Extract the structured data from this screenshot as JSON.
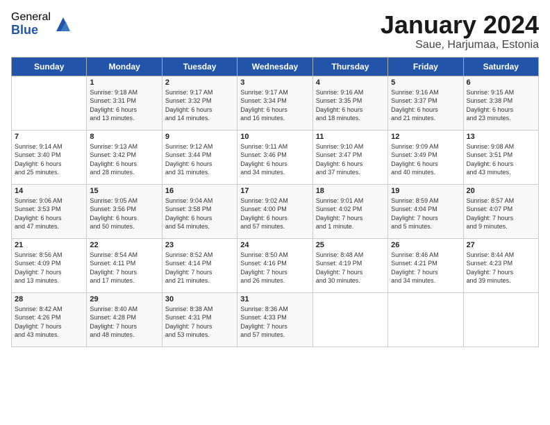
{
  "logo": {
    "general": "General",
    "blue": "Blue"
  },
  "title": "January 2024",
  "location": "Saue, Harjumaa, Estonia",
  "days_header": [
    "Sunday",
    "Monday",
    "Tuesday",
    "Wednesday",
    "Thursday",
    "Friday",
    "Saturday"
  ],
  "weeks": [
    [
      {
        "day": "",
        "info": ""
      },
      {
        "day": "1",
        "info": "Sunrise: 9:18 AM\nSunset: 3:31 PM\nDaylight: 6 hours\nand 13 minutes."
      },
      {
        "day": "2",
        "info": "Sunrise: 9:17 AM\nSunset: 3:32 PM\nDaylight: 6 hours\nand 14 minutes."
      },
      {
        "day": "3",
        "info": "Sunrise: 9:17 AM\nSunset: 3:34 PM\nDaylight: 6 hours\nand 16 minutes."
      },
      {
        "day": "4",
        "info": "Sunrise: 9:16 AM\nSunset: 3:35 PM\nDaylight: 6 hours\nand 18 minutes."
      },
      {
        "day": "5",
        "info": "Sunrise: 9:16 AM\nSunset: 3:37 PM\nDaylight: 6 hours\nand 21 minutes."
      },
      {
        "day": "6",
        "info": "Sunrise: 9:15 AM\nSunset: 3:38 PM\nDaylight: 6 hours\nand 23 minutes."
      }
    ],
    [
      {
        "day": "7",
        "info": "Sunrise: 9:14 AM\nSunset: 3:40 PM\nDaylight: 6 hours\nand 25 minutes."
      },
      {
        "day": "8",
        "info": "Sunrise: 9:13 AM\nSunset: 3:42 PM\nDaylight: 6 hours\nand 28 minutes."
      },
      {
        "day": "9",
        "info": "Sunrise: 9:12 AM\nSunset: 3:44 PM\nDaylight: 6 hours\nand 31 minutes."
      },
      {
        "day": "10",
        "info": "Sunrise: 9:11 AM\nSunset: 3:46 PM\nDaylight: 6 hours\nand 34 minutes."
      },
      {
        "day": "11",
        "info": "Sunrise: 9:10 AM\nSunset: 3:47 PM\nDaylight: 6 hours\nand 37 minutes."
      },
      {
        "day": "12",
        "info": "Sunrise: 9:09 AM\nSunset: 3:49 PM\nDaylight: 6 hours\nand 40 minutes."
      },
      {
        "day": "13",
        "info": "Sunrise: 9:08 AM\nSunset: 3:51 PM\nDaylight: 6 hours\nand 43 minutes."
      }
    ],
    [
      {
        "day": "14",
        "info": "Sunrise: 9:06 AM\nSunset: 3:53 PM\nDaylight: 6 hours\nand 47 minutes."
      },
      {
        "day": "15",
        "info": "Sunrise: 9:05 AM\nSunset: 3:56 PM\nDaylight: 6 hours\nand 50 minutes."
      },
      {
        "day": "16",
        "info": "Sunrise: 9:04 AM\nSunset: 3:58 PM\nDaylight: 6 hours\nand 54 minutes."
      },
      {
        "day": "17",
        "info": "Sunrise: 9:02 AM\nSunset: 4:00 PM\nDaylight: 6 hours\nand 57 minutes."
      },
      {
        "day": "18",
        "info": "Sunrise: 9:01 AM\nSunset: 4:02 PM\nDaylight: 7 hours\nand 1 minute."
      },
      {
        "day": "19",
        "info": "Sunrise: 8:59 AM\nSunset: 4:04 PM\nDaylight: 7 hours\nand 5 minutes."
      },
      {
        "day": "20",
        "info": "Sunrise: 8:57 AM\nSunset: 4:07 PM\nDaylight: 7 hours\nand 9 minutes."
      }
    ],
    [
      {
        "day": "21",
        "info": "Sunrise: 8:56 AM\nSunset: 4:09 PM\nDaylight: 7 hours\nand 13 minutes."
      },
      {
        "day": "22",
        "info": "Sunrise: 8:54 AM\nSunset: 4:11 PM\nDaylight: 7 hours\nand 17 minutes."
      },
      {
        "day": "23",
        "info": "Sunrise: 8:52 AM\nSunset: 4:14 PM\nDaylight: 7 hours\nand 21 minutes."
      },
      {
        "day": "24",
        "info": "Sunrise: 8:50 AM\nSunset: 4:16 PM\nDaylight: 7 hours\nand 26 minutes."
      },
      {
        "day": "25",
        "info": "Sunrise: 8:48 AM\nSunset: 4:19 PM\nDaylight: 7 hours\nand 30 minutes."
      },
      {
        "day": "26",
        "info": "Sunrise: 8:46 AM\nSunset: 4:21 PM\nDaylight: 7 hours\nand 34 minutes."
      },
      {
        "day": "27",
        "info": "Sunrise: 8:44 AM\nSunset: 4:23 PM\nDaylight: 7 hours\nand 39 minutes."
      }
    ],
    [
      {
        "day": "28",
        "info": "Sunrise: 8:42 AM\nSunset: 4:26 PM\nDaylight: 7 hours\nand 43 minutes."
      },
      {
        "day": "29",
        "info": "Sunrise: 8:40 AM\nSunset: 4:28 PM\nDaylight: 7 hours\nand 48 minutes."
      },
      {
        "day": "30",
        "info": "Sunrise: 8:38 AM\nSunset: 4:31 PM\nDaylight: 7 hours\nand 53 minutes."
      },
      {
        "day": "31",
        "info": "Sunrise: 8:36 AM\nSunset: 4:33 PM\nDaylight: 7 hours\nand 57 minutes."
      },
      {
        "day": "",
        "info": ""
      },
      {
        "day": "",
        "info": ""
      },
      {
        "day": "",
        "info": ""
      }
    ]
  ]
}
